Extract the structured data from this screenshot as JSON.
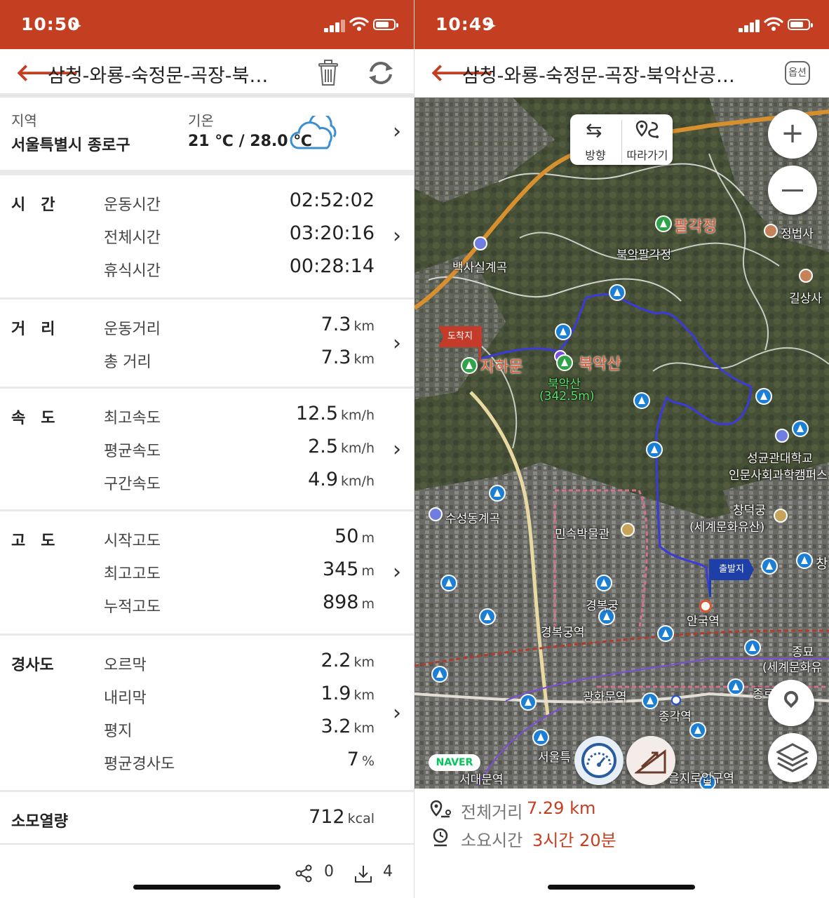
{
  "left": {
    "status_time": "10:50",
    "title": "삼청-와룡-숙정문-곡장-북…",
    "region_label": "지역",
    "region_value": "서울특별시 종로구",
    "temp_label": "기온",
    "temp_value": "21 ℃ / 28.0 ℃",
    "sections": {
      "time": {
        "label": "시　간",
        "rows": [
          {
            "name": "운동시간",
            "value": "02:52:02",
            "unit": ""
          },
          {
            "name": "전체시간",
            "value": "03:20:16",
            "unit": ""
          },
          {
            "name": "휴식시간",
            "value": "00:28:14",
            "unit": ""
          }
        ]
      },
      "distance": {
        "label": "거　리",
        "rows": [
          {
            "name": "운동거리",
            "value": "7.3",
            "unit": "km"
          },
          {
            "name": "총 거리",
            "value": "7.3",
            "unit": "km"
          }
        ]
      },
      "speed": {
        "label": "속　도",
        "rows": [
          {
            "name": "최고속도",
            "value": "12.5",
            "unit": "km/h"
          },
          {
            "name": "평균속도",
            "value": "2.5",
            "unit": "km/h"
          },
          {
            "name": "구간속도",
            "value": "4.9",
            "unit": "km/h"
          }
        ]
      },
      "altitude": {
        "label": "고　도",
        "rows": [
          {
            "name": "시작고도",
            "value": "50",
            "unit": "m"
          },
          {
            "name": "최고고도",
            "value": "345",
            "unit": "m"
          },
          {
            "name": "누적고도",
            "value": "898",
            "unit": "m"
          }
        ]
      },
      "slope": {
        "label": "경사도",
        "rows": [
          {
            "name": "오르막",
            "value": "2.2",
            "unit": "km"
          },
          {
            "name": "내리막",
            "value": "1.9",
            "unit": "km"
          },
          {
            "name": "평지",
            "value": "3.2",
            "unit": "km"
          },
          {
            "name": "평균경사도",
            "value": "7",
            "unit": "%"
          }
        ]
      }
    },
    "calories_label": "소모열량",
    "calories_value": "712",
    "calories_unit": "kcal",
    "share_count": "0",
    "download_count": "4"
  },
  "right": {
    "status_time": "10:49",
    "title": "삼청-와룡-숙정문-곡장-북악산공…",
    "options_label": "옵션",
    "direction_label": "방향",
    "follow_label": "따라가기",
    "map_labels": {
      "palgakjeong": "팔각정",
      "bugak_palgakjeong": "북악팔각정",
      "jeongbeopsa": "정법사",
      "baeksasil": "백사실계곡",
      "gilsangsa": "길상사",
      "finish_flag": "도착지",
      "start_flag": "출발지",
      "changuimun": "자하문",
      "bugaksan": "북악산",
      "bugaksan_peak": "북악산",
      "bugaksan_height": "(342.5m)",
      "skku_1": "성균관대학교",
      "skku_2": "인문사회과학캠퍼스",
      "changdeokgung_1": "창덕궁",
      "changdeokgung_2": "(세계문화유산)",
      "suseongdong": "수성동계곡",
      "folk_museum": "민속박물관",
      "gyeongbokgung": "경복궁",
      "gyeongbokgung_stn": "경복궁역",
      "anguk_stn": "안국역",
      "jongmyo_1": "종묘",
      "jongmyo_2": "(세계문화유",
      "gwanghwamun_stn": "광화문역",
      "jonggak_stn": "종각역",
      "seoul_stn": "서울특",
      "seodaemun_stn": "서대문역",
      "euljiro_stn": "을지로입구역",
      "chang_partial": "창",
      "jong_partial": "종로",
      "naver": "NAVER"
    },
    "total_distance_label": "전체거리",
    "total_distance_value": "7.29 km",
    "duration_label": "소요시간",
    "duration_value": "3시간 20분"
  },
  "colors": {
    "brand": "#c43f22",
    "route": "#3b3bd8",
    "accent_text": "#c43f22"
  }
}
